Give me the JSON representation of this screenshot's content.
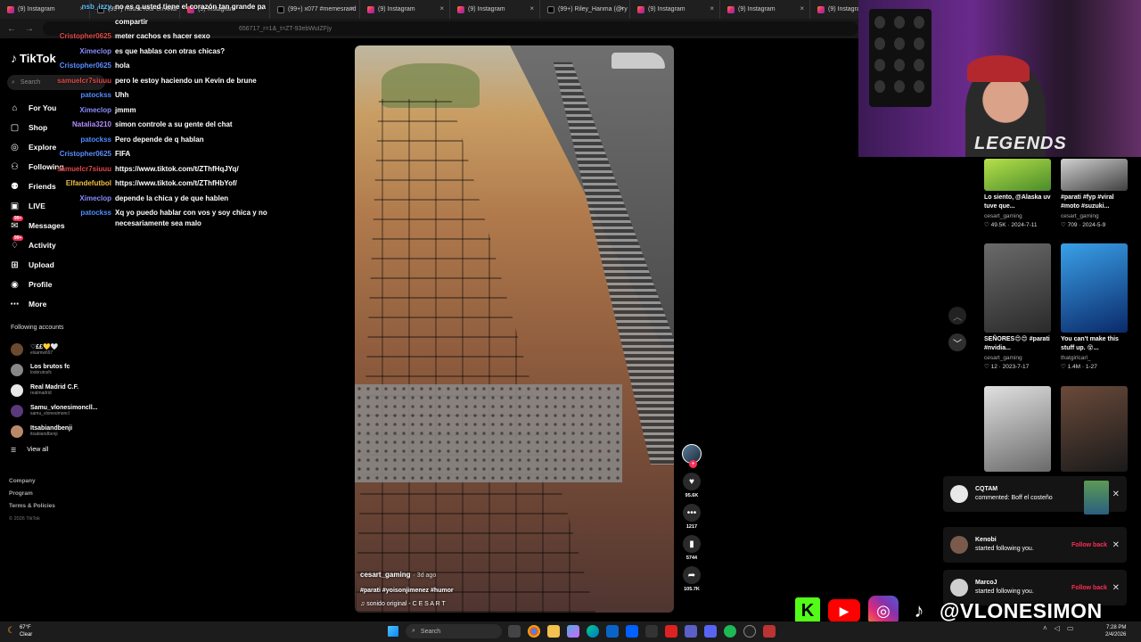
{
  "browser": {
    "tabs": [
      {
        "label": "(9) Instagram",
        "icon": "instagram"
      },
      {
        "label": "(99+) HouseTour en Andr",
        "icon": "tiktok"
      },
      {
        "label": "(9) Instagram",
        "icon": "instagram"
      },
      {
        "label": "(99+) x077 #memesrand",
        "icon": "tiktok"
      },
      {
        "label": "(9) Instagram",
        "icon": "instagram"
      },
      {
        "label": "(9) Instagram",
        "icon": "instagram"
      },
      {
        "label": "(99+) Riley_Hanma (@ry",
        "icon": "tiktok"
      },
      {
        "label": "(9) Instagram",
        "icon": "instagram"
      },
      {
        "label": "(9) Instagram",
        "icon": "instagram"
      },
      {
        "label": "(9) Instagram",
        "icon": "instagram"
      }
    ],
    "url": "656717_r=1&_t=ZT-93ebWuIZFjy"
  },
  "tiktok": {
    "logo": "TikTok",
    "search_placeholder": "Search",
    "nav": [
      {
        "label": "For You",
        "icon": "home-icon"
      },
      {
        "label": "Shop",
        "icon": "bag-icon"
      },
      {
        "label": "Explore",
        "icon": "compass-icon"
      },
      {
        "label": "Following",
        "icon": "following-icon"
      },
      {
        "label": "Friends",
        "icon": "friends-icon"
      },
      {
        "label": "LIVE",
        "icon": "live-icon"
      },
      {
        "label": "Messages",
        "icon": "messages-icon",
        "badge": "99+"
      },
      {
        "label": "Activity",
        "icon": "activity-icon",
        "badge": "99+"
      },
      {
        "label": "Upload",
        "icon": "upload-icon"
      },
      {
        "label": "Profile",
        "icon": "profile-icon"
      },
      {
        "label": "More",
        "icon": "more-icon"
      }
    ],
    "following_title": "Following accounts",
    "following_accounts": [
      {
        "name": "♡££💛🤍",
        "handle": "elsamw697"
      },
      {
        "name": "Los brutos fc",
        "handle": "losbrutosfc"
      },
      {
        "name": "Real Madrid C.F.",
        "handle": "realmadrid"
      },
      {
        "name": "Samu_vlonesimoncll...",
        "handle": "samu_vlonesimoncl"
      },
      {
        "name": "Itsabiandbenji",
        "handle": "itsabiandbenji"
      }
    ],
    "view_all": "View all",
    "footer": [
      "Company",
      "Program",
      "Terms & Policies"
    ],
    "copyright": "© 2026 TikTok"
  },
  "chat": [
    {
      "user": "nsb_izzy",
      "text": "no es q usted tiene el corazón tan grande pa",
      "color": "#5ec2ff"
    },
    {
      "user": "",
      "text": "compartir",
      "color": "#ffffff"
    },
    {
      "user": "Cristopher0625",
      "text": "meter cachos es hacer sexo",
      "color": "#e04848"
    },
    {
      "user": "Ximeclop",
      "text": "es que hablas con otras chicas?",
      "color": "#8b8bff"
    },
    {
      "user": "Cristopher0625",
      "text": "hola",
      "color": "#5b8dff"
    },
    {
      "user": "samuelcr7siuuu",
      "text": "pero le estoy haciendo un Kevin de brune",
      "color": "#e24848"
    },
    {
      "user": "patockss",
      "text": "Uhh",
      "color": "#4f8cff"
    },
    {
      "user": "Ximeclop",
      "text": "jmmm",
      "color": "#8b8bff"
    },
    {
      "user": "Natalia3210",
      "text": "simon controle a su gente del chat",
      "color": "#b48cff"
    },
    {
      "user": "patockss",
      "text": "Pero depende de q hablan",
      "color": "#4f8cff"
    },
    {
      "user": "Cristopher0625",
      "text": "FIFA",
      "color": "#5b8dff"
    },
    {
      "user": "samuelcr7siuuu",
      "text": "https://www.tiktok.com/t/ZThfHqJYq/",
      "color": "#e24848"
    },
    {
      "user": "Elfandefutbol",
      "text": "https://www.tiktok.com/t/ZThfHbYof/",
      "color": "#f0c040"
    },
    {
      "user": "Ximeclop",
      "text": "depende la chica y de que hablen",
      "color": "#8b8bff"
    },
    {
      "user": "patockss",
      "text": "Xq yo puedo hablar con vos y soy chica y no necesariamente sea malo",
      "color": "#4f8cff"
    }
  ],
  "video": {
    "author": "cesart_gaming",
    "ago": "· 3d ago",
    "tags": "#parati #yoisonjimenez #humor",
    "sound": "sonido original - C E S A R T",
    "likes": "95.6K",
    "comments": "1217",
    "saves": "5744",
    "shares": "105.7K"
  },
  "grid": [
    {
      "desc": "Lo siento, @Alaska uv tuve que...",
      "author": "cesart_gaming",
      "stats": "♡ 49.5K · 2024-7-11",
      "colors": [
        "#b6e04a",
        "#4a8c2a"
      ]
    },
    {
      "desc": "#parati #fyp #viral #moto #suzuki...",
      "author": "cesart_gaming",
      "stats": "♡ 709 · 2024-5-9",
      "colors": [
        "#d0d0d0",
        "#404040"
      ]
    },
    {
      "desc": "SEÑORES😍😍 #parati #nvidia...",
      "author": "cesart_gaming",
      "stats": "♡ 12 · 2023-7-17",
      "colors": [
        "#6a6a6a",
        "#2a2a2a"
      ]
    },
    {
      "desc": "You can't make this stuff up. 😵...",
      "author": "thatgirlcarl_",
      "stats": "♡ 1.4M · 1-27",
      "colors": [
        "#3aa0e8",
        "#0a2a6a"
      ]
    },
    {
      "desc": "",
      "author": "",
      "stats": "",
      "colors": [
        "#e0e0e0",
        "#6a6a6a"
      ]
    },
    {
      "desc": "",
      "author": "",
      "stats": "",
      "colors": [
        "#6a4a3a",
        "#1a1a1a"
      ]
    }
  ],
  "notifications": [
    {
      "name": "CQTAM",
      "text": "commented: Boff el costeño",
      "action": ""
    },
    {
      "name": "Kenobi",
      "text": "started following you.",
      "action": "Follow back"
    },
    {
      "name": "MarcoJ",
      "text": "started following you.",
      "action": "Follow back"
    }
  ],
  "stream": {
    "webcam_text": "LEGENDS",
    "handle": "@VLONESIMON",
    "social_icons": [
      "kick-icon",
      "youtube-icon",
      "instagram-icon",
      "tiktok-icon"
    ]
  },
  "taskbar": {
    "temp": "67°F",
    "weather": "Clear",
    "search": "Search",
    "time": "7:28 PM",
    "date": "2/4/2026"
  }
}
